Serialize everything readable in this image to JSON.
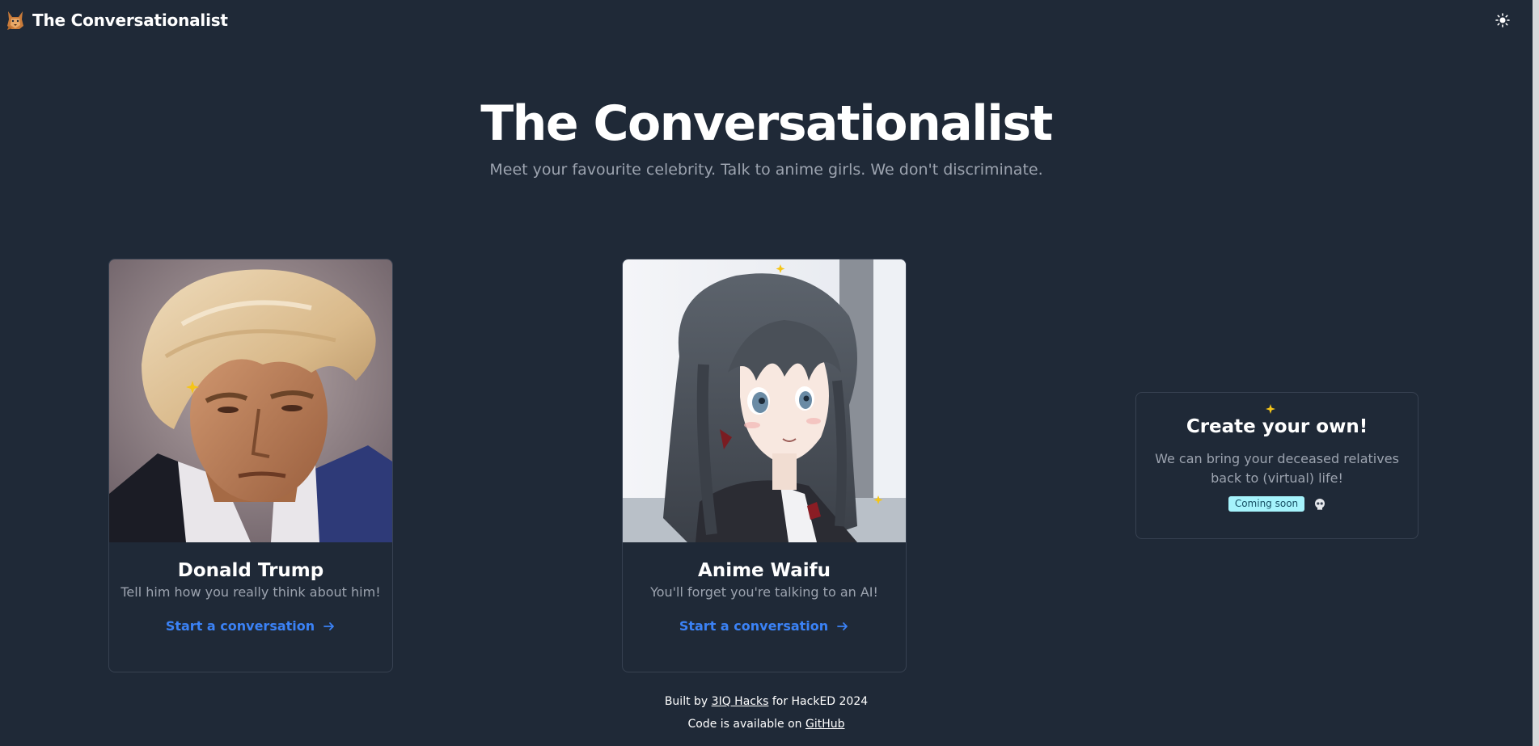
{
  "app": {
    "name": "The Conversationalist"
  },
  "navbar": {
    "brand_name": "The Conversationalist",
    "brand_logo_icon": "fox-logo-icon",
    "theme_toggle_icon": "sun-icon"
  },
  "hero": {
    "title": "The Conversationalist",
    "subtitle": "Meet your favourite celebrity. Talk to anime girls. We don't discriminate."
  },
  "cards": [
    {
      "name": "Donald Trump",
      "description": "Tell him how you really think about him!",
      "link_label": "Start a conversation",
      "link_icon": "arrow-right-icon",
      "image": "portrait-photo"
    },
    {
      "name": "Anime Waifu",
      "description": "You'll forget you're talking to an AI!",
      "link_label": "Start a conversation",
      "link_icon": "arrow-right-icon",
      "image": "anime-illustration"
    }
  ],
  "create_card": {
    "title": "Create your own!",
    "description": "We can bring your deceased relatives back to (virtual) life!",
    "badge": "Coming soon",
    "badge_icon": "skull-emoji-icon"
  },
  "footer": {
    "line1_prefix": "Built by",
    "line1_link": "3IQ Hacks",
    "line1_suffix": "for HackED 2024",
    "line2_prefix": "Code is available on",
    "line2_link": "GitHub"
  },
  "colors": {
    "background": "#1f2937",
    "accent_link": "#3b82f6",
    "muted_text": "#9ca3af",
    "badge_bg": "#a5f3fc",
    "sparkle": "#f5c518"
  }
}
